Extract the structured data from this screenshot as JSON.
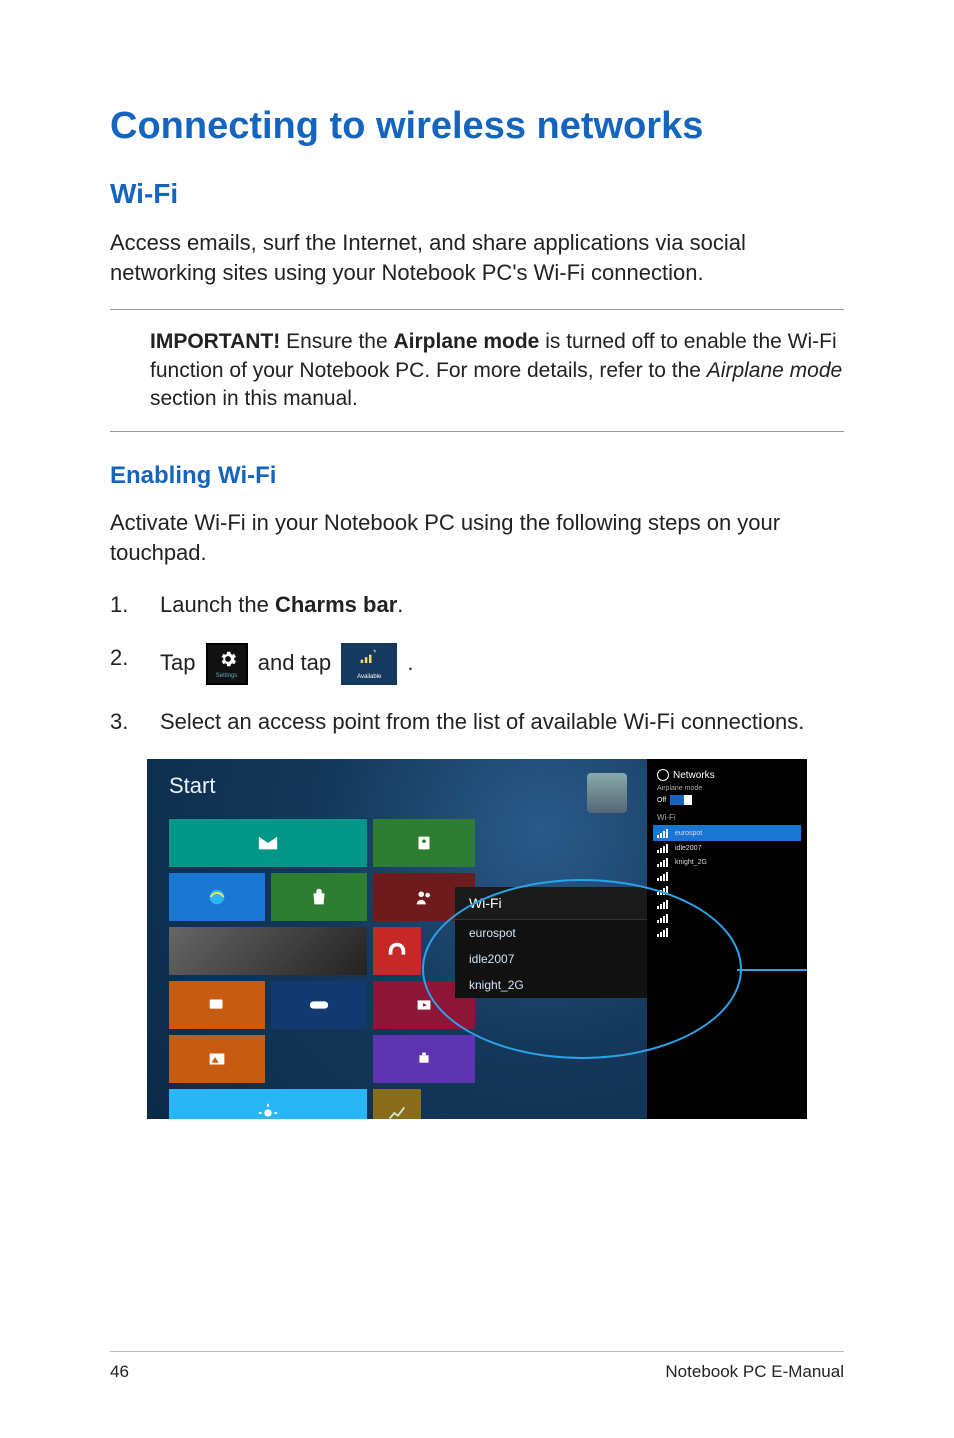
{
  "page": {
    "title": "Connecting to wireless networks",
    "subtitle": "Wi-Fi",
    "intro": "Access emails, surf the Internet, and share applications via social networking sites using your Notebook PC's Wi-Fi connection.",
    "callout": {
      "label": "IMPORTANT!",
      "text_before": " Ensure the ",
      "bold_term": "Airplane mode",
      "text_mid": " is turned off to enable the Wi-Fi function of your Notebook PC. For more details, refer to the ",
      "italic_term": "Airplane mode",
      "text_after": " section in this manual."
    },
    "section_heading": "Enabling Wi-Fi",
    "section_intro": "Activate Wi-Fi in your Notebook PC using the following steps on your touchpad.",
    "steps": {
      "s1_a": "Launch the ",
      "s1_bold": "Charms bar",
      "s1_b": ".",
      "s2_a": "Tap ",
      "s2_b": " and tap ",
      "s2_c": ".",
      "s3": "Select an access point from the list of available Wi-Fi connections."
    },
    "icons": {
      "settings_label": "Settings",
      "available_label": "Available"
    }
  },
  "screenshot": {
    "start_label": "Start",
    "networks_panel": {
      "header": "Networks",
      "airplane_label": "Airplane mode",
      "airplane_state": "Off",
      "wifi_label": "Wi-Fi",
      "rows": [
        "eurospot",
        "idle2007",
        "knight_2G"
      ],
      "extra_rows": [
        "",
        "",
        "",
        "",
        ""
      ]
    },
    "wifi_popup": {
      "title": "Wi-Fi",
      "items": [
        "eurospot",
        "idle2007",
        "knight_2G"
      ]
    }
  },
  "footer": {
    "page_number": "46",
    "doc_title": "Notebook PC E-Manual"
  }
}
